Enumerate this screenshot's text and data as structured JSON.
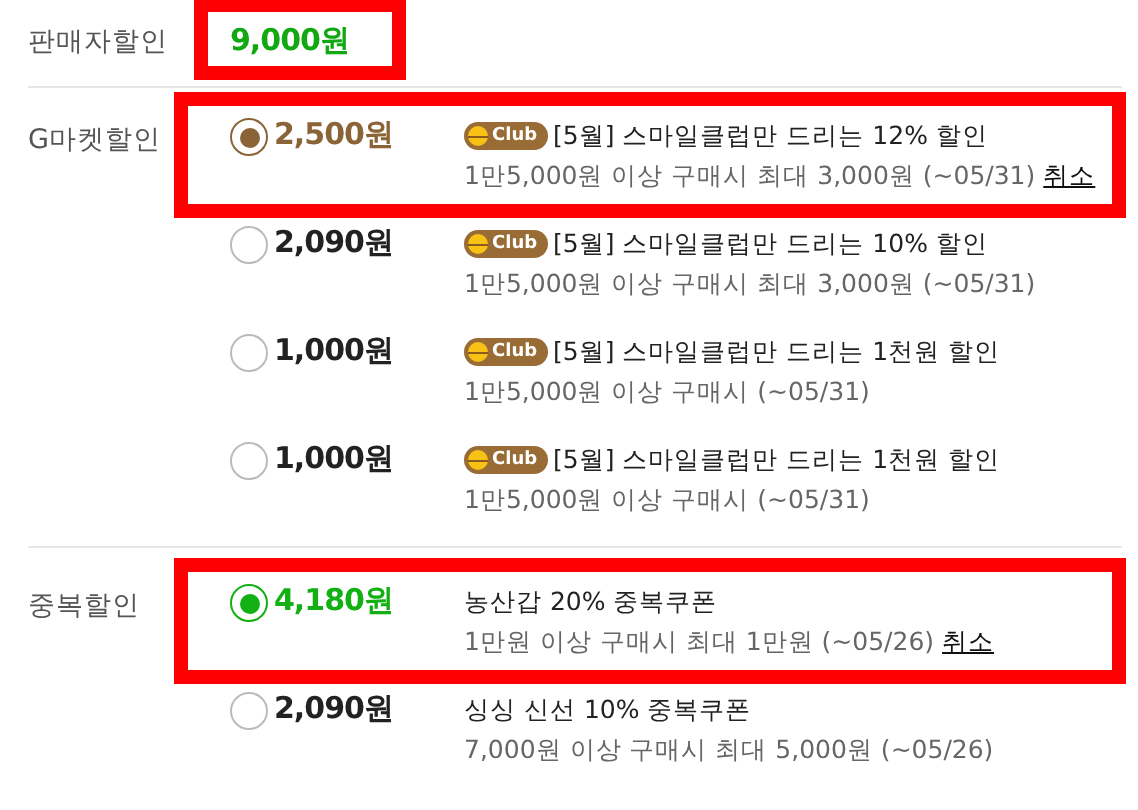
{
  "sections": [
    {
      "label": "판매자할인",
      "kind": "plain",
      "color": "#12a812",
      "options": [
        {
          "price": "9,000원",
          "highlighted": true
        }
      ]
    },
    {
      "label": "G마켓할인",
      "kind": "radio",
      "color": "#8a6436",
      "options": [
        {
          "price": "2,500원",
          "selected": true,
          "highlighted": true,
          "badge": "Club",
          "title": "[5월] 스마일클럽만 드리는 12% 할인",
          "detail": "1만5,000원 이상 구매시 최대 3,000원 (~05/31)",
          "cancel": "취소"
        },
        {
          "price": "2,090원",
          "selected": false,
          "highlighted": false,
          "badge": "Club",
          "title": "[5월] 스마일클럽만 드리는 10% 할인",
          "detail": "1만5,000원 이상 구매시 최대 3,000원 (~05/31)"
        },
        {
          "price": "1,000원",
          "selected": false,
          "highlighted": false,
          "badge": "Club",
          "title": "[5월] 스마일클럽만 드리는 1천원 할인",
          "detail": "1만5,000원 이상 구매시 (~05/31)"
        },
        {
          "price": "1,000원",
          "selected": false,
          "highlighted": false,
          "badge": "Club",
          "title": "[5월] 스마일클럽만 드리는 1천원 할인",
          "detail": "1만5,000원 이상 구매시 (~05/31)"
        }
      ]
    },
    {
      "label": "중복할인",
      "kind": "radio",
      "color": "#12b012",
      "options": [
        {
          "price": "4,180원",
          "selected": true,
          "highlighted": true,
          "title": "농산갑 20% 중복쿠폰",
          "detail": "1만원 이상 구매시 최대 1만원 (~05/26)",
          "cancel": "취소"
        },
        {
          "price": "2,090원",
          "selected": false,
          "highlighted": false,
          "title": "싱싱 신선 10% 중복쿠폰",
          "detail": "7,000원 이상 구매시 최대 5,000원 (~05/26)"
        }
      ]
    }
  ]
}
